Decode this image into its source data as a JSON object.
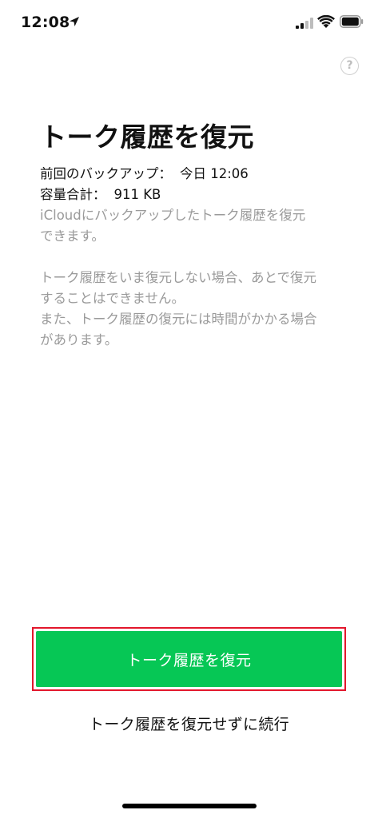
{
  "status_bar": {
    "time": "12:08"
  },
  "help": {
    "label": "?"
  },
  "title": "トーク履歴を復元",
  "info": {
    "backup_label": "前回のバックアップ：",
    "backup_value": "今日 12:06",
    "size_label": "容量合計：",
    "size_value": "911 KB"
  },
  "description": "iCloudにバックアップしたトーク履歴を復元\nできます。",
  "warning": "トーク履歴をいま復元しない場合、あとで復元\nすることはできません。\nまた、トーク履歴の復元には時間がかかる場合\nがあります。",
  "buttons": {
    "restore_label": "トーク履歴を復元",
    "skip_label": "トーク履歴を復元せずに続行"
  },
  "colors": {
    "primary_button": "#06c755",
    "highlight_border": "#e2172c",
    "secondary_text": "#9a9a9a"
  },
  "icons": {
    "location": "location-arrow-icon",
    "signal": "cellular-signal-icon",
    "wifi": "wifi-icon",
    "battery": "battery-icon",
    "help": "help-icon"
  }
}
